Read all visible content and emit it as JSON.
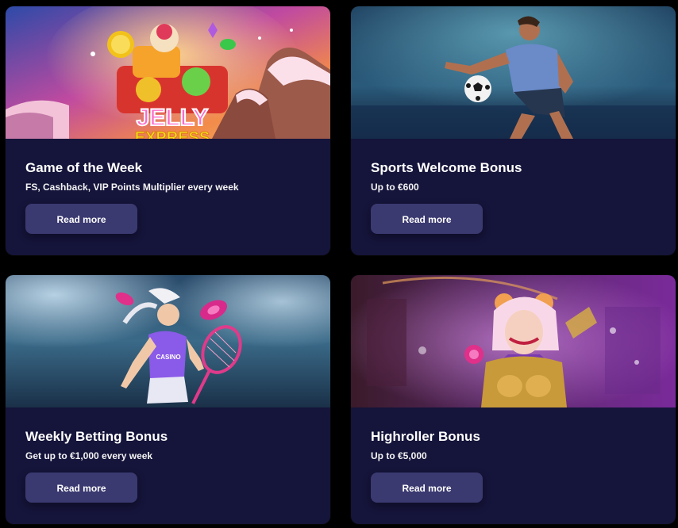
{
  "promotions": [
    {
      "title": "Game of the Week",
      "subtitle": "FS, Cashback, VIP Points Multiplier every week",
      "button_label": "Read more",
      "image_text": "JELLY EXPRESS"
    },
    {
      "title": "Sports Welcome Bonus",
      "subtitle": "Up to €600",
      "button_label": "Read more"
    },
    {
      "title": "Weekly Betting Bonus",
      "subtitle": "Get up to €1,000 every week",
      "button_label": "Read more",
      "image_text": "CASINO"
    },
    {
      "title": "Highroller Bonus",
      "subtitle": "Up to €5,000",
      "button_label": "Read more"
    }
  ],
  "colors": {
    "card_bg": "#15143a",
    "button_bg": "#3a3970",
    "page_bg": "#000000",
    "text": "#ffffff"
  }
}
